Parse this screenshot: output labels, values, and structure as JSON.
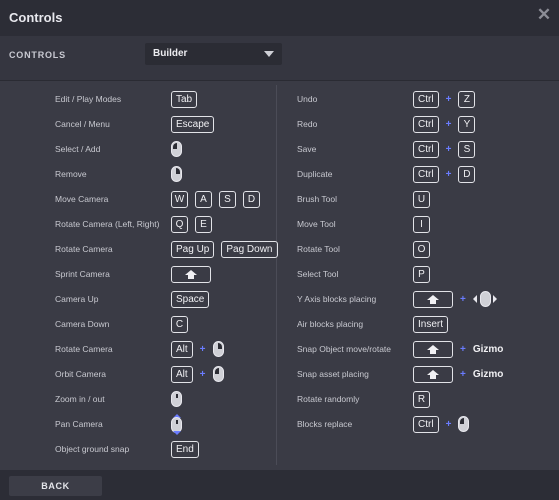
{
  "window": {
    "title": "Controls",
    "close_icon": "close-icon"
  },
  "controls": {
    "label": "CONTROLS",
    "selected": "Builder"
  },
  "left_rows": [
    {
      "label": "Edit / Play Modes",
      "keys": [
        "Tab"
      ]
    },
    {
      "label": "Cancel / Menu",
      "keys": [
        "Escape"
      ]
    },
    {
      "label": "Select / Add",
      "mouse": "left-click-icon"
    },
    {
      "label": "Remove",
      "mouse": "right-click-icon"
    },
    {
      "label": "Move Camera",
      "keys": [
        "W",
        "A",
        "S",
        "D"
      ]
    },
    {
      "label": "Rotate Camera (Left, Right)",
      "keys": [
        "Q",
        "E"
      ]
    },
    {
      "label": "Rotate Camera",
      "keys": [
        "Pag Up",
        "Pag Down"
      ]
    },
    {
      "label": "Sprint Camera",
      "shift": "shift-key-icon"
    },
    {
      "label": "Camera Up",
      "keys": [
        "Space"
      ]
    },
    {
      "label": "Camera Down",
      "keys": [
        "C"
      ]
    },
    {
      "label": "Rotate Camera",
      "keys": [
        "Alt"
      ],
      "plus": "+",
      "mouse": "right-click-icon"
    },
    {
      "label": "Orbit Camera",
      "keys": [
        "Alt"
      ],
      "plus": "+",
      "mouse": "left-click-icon"
    },
    {
      "label": "Zoom in / out",
      "mouse": "scroll-wheel-icon"
    },
    {
      "label": "Pan Camera",
      "mouse": "middle-drag-icon"
    },
    {
      "label": "Object ground snap",
      "keys": [
        "End"
      ]
    }
  ],
  "right_rows": [
    {
      "label": "Undo",
      "keys": [
        "Ctrl"
      ],
      "plus": "+",
      "keys2": [
        "Z"
      ]
    },
    {
      "label": "Redo",
      "keys": [
        "Ctrl"
      ],
      "plus": "+",
      "keys2": [
        "Y"
      ]
    },
    {
      "label": "Save",
      "keys": [
        "Ctrl"
      ],
      "plus": "+",
      "keys2": [
        "S"
      ]
    },
    {
      "label": "Duplicate",
      "keys": [
        "Ctrl"
      ],
      "plus": "+",
      "keys2": [
        "D"
      ]
    },
    {
      "label": "Brush Tool",
      "keys": [
        "U"
      ]
    },
    {
      "label": "Move Tool",
      "keys": [
        "I"
      ]
    },
    {
      "label": "Rotate Tool",
      "keys": [
        "O"
      ]
    },
    {
      "label": "Select Tool",
      "keys": [
        "P"
      ]
    },
    {
      "label": "Y Axis blocks placing",
      "shift": "shift-key-icon",
      "plus": "+",
      "mouse": "mouse-move-horizontal-icon"
    },
    {
      "label": "Air blocks placing",
      "keys": [
        "Insert"
      ]
    },
    {
      "label": "Snap Object move/rotate",
      "shift": "shift-key-icon",
      "plus": "+",
      "word": "Gizmo"
    },
    {
      "label": "Snap asset placing",
      "shift": "shift-key-icon",
      "plus": "+",
      "word": "Gizmo"
    },
    {
      "label": "Rotate randomly",
      "keys": [
        "R"
      ]
    },
    {
      "label": "Blocks replace",
      "keys": [
        "Ctrl"
      ],
      "plus": "+",
      "mouse": "left-click-icon"
    }
  ],
  "footer": {
    "back_label": "BACK"
  },
  "colors": {
    "background": "#3a3b45",
    "header": "#2c2d36",
    "accent_plus": "#6a7cff",
    "key_border": "#e2e3e8"
  }
}
